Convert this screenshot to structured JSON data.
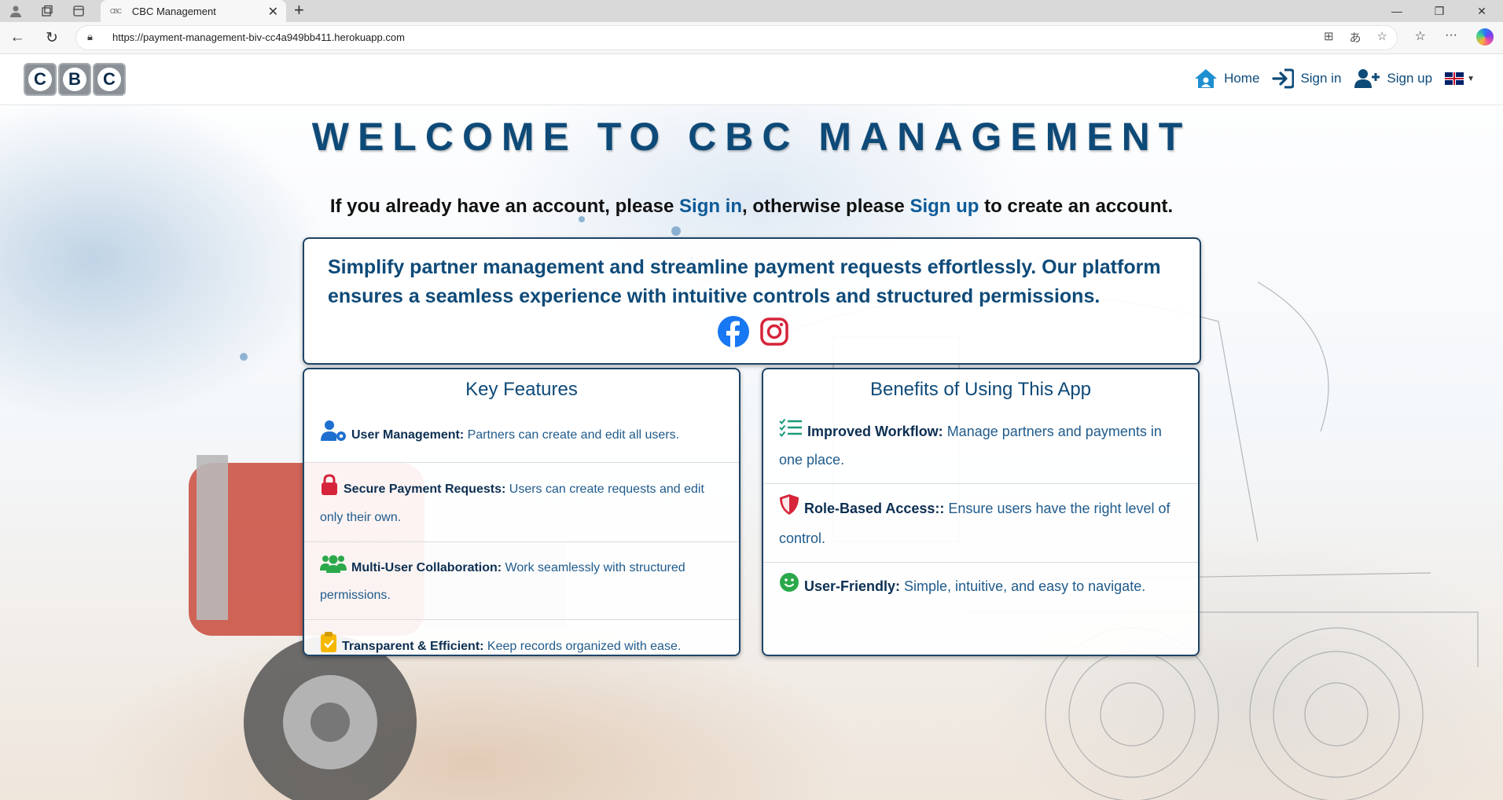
{
  "browser": {
    "tab_title": "CBC Management",
    "tab_favicon": "CBC",
    "url": "https://payment-management-biv-cc4a949bb411.herokuapp.com"
  },
  "navbar": {
    "logo_letters": [
      "C",
      "B",
      "C"
    ],
    "home_label": "Home",
    "signin_label": "Sign in",
    "signup_label": "Sign up",
    "language": "en-GB"
  },
  "hero": {
    "title": "WELCOME TO CBC MANAGEMENT",
    "subline_part1": "If you already have an account, please ",
    "subline_signin": "Sign in",
    "subline_part2": ", otherwise please ",
    "subline_signup": "Sign up",
    "subline_part3": " to create an account."
  },
  "intro": {
    "text": "Simplify partner management and streamline payment requests effortlessly. Our platform ensures a seamless experience with intuitive controls and structured permissions.",
    "social": [
      "facebook-icon",
      "instagram-icon"
    ]
  },
  "features": {
    "heading": "Key Features",
    "items": [
      {
        "icon": "user-gear-icon",
        "title": "User Management:",
        "text": " Partners can create and edit all users."
      },
      {
        "icon": "lock-icon",
        "title": "Secure Payment Requests:",
        "text": " Users can create requests and edit only their own."
      },
      {
        "icon": "users-icon",
        "title": "Multi-User Collaboration:",
        "text": " Work seamlessly with structured permissions."
      },
      {
        "icon": "clipboard-check-icon",
        "title": "Transparent & Efficient:",
        "text": " Keep records organized with ease."
      }
    ]
  },
  "benefits": {
    "heading": "Benefits of Using This App",
    "items": [
      {
        "icon": "list-check-icon",
        "title": "Improved Workflow:",
        "text": " Manage partners and payments in one place."
      },
      {
        "icon": "shield-icon",
        "title": "Role-Based Access::",
        "text": " Ensure users have the right level of control."
      },
      {
        "icon": "smile-icon",
        "title": "User-Friendly:",
        "text": " Simple, intuitive, and easy to navigate."
      }
    ]
  },
  "colors": {
    "primary": "#0e4a78",
    "link": "#0d5b98",
    "lock": "#d6243a",
    "users": "#2aa84a",
    "clipboard": "#f5b800",
    "shield": "#d6243a",
    "smile": "#2aa84a"
  }
}
